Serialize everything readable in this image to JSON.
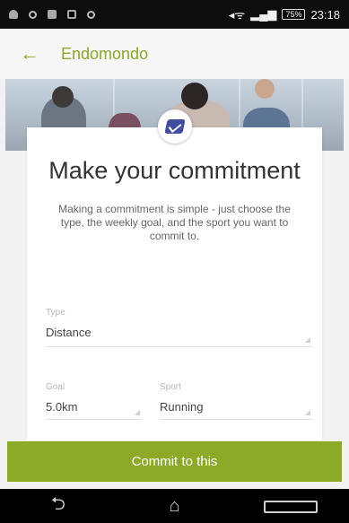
{
  "status_bar": {
    "battery": "75%",
    "time": "23:18"
  },
  "app_bar": {
    "title": "Endomondo",
    "back_glyph": "←"
  },
  "card": {
    "title": "Make your commitment",
    "description": "Making a commitment is simple - just choose the type, the weekly goal, and the sport you want to commit to."
  },
  "form": {
    "type": {
      "label": "Type",
      "value": "Distance"
    },
    "goal": {
      "label": "Goal",
      "value": "5.0km"
    },
    "sport": {
      "label": "Sport",
      "value": "Running"
    }
  },
  "commit_button": {
    "label": "Commit to this"
  },
  "nav": {
    "back_glyph": "⮌",
    "home_glyph": "⌂"
  },
  "colors": {
    "accent": "#8caa28",
    "status_bar": "#0d0d0d",
    "nav_bar": "#000000"
  },
  "icons": [
    "back-arrow-icon",
    "commitment-badge-icon",
    "nav-back-icon",
    "nav-home-icon",
    "nav-recent-icon",
    "wifi-icon",
    "signal-icon",
    "battery-icon"
  ]
}
